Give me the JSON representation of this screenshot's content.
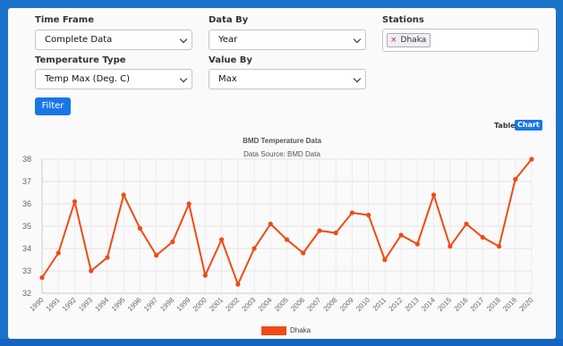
{
  "filters": {
    "time_frame": {
      "label": "Time Frame",
      "value": "Complete Data"
    },
    "data_by": {
      "label": "Data By",
      "value": "Year"
    },
    "stations": {
      "label": "Stations",
      "tags": [
        {
          "remove": "×",
          "name": "Dhaka"
        }
      ]
    },
    "temperature_type": {
      "label": "Temperature Type",
      "value": "Temp Max (Deg. C)"
    },
    "value_by": {
      "label": "Value By",
      "value": "Max"
    }
  },
  "filter_button": "Filter",
  "view_toggle": {
    "table": "Table",
    "chart": "Chart"
  },
  "colors": {
    "series": "#f04a14",
    "button": "#1976e8",
    "frame": "#1a73c8"
  },
  "chart_data": {
    "type": "line",
    "title": "BMD Temperature Data",
    "subtitle": "Data Source: BMD Data",
    "x": [
      "1990",
      "1991",
      "1992",
      "1993",
      "1994",
      "1995",
      "1996",
      "1997",
      "1998",
      "1999",
      "2000",
      "2001",
      "2002",
      "2003",
      "2004",
      "2005",
      "2006",
      "2007",
      "2008",
      "2009",
      "2010",
      "2011",
      "2012",
      "2013",
      "2014",
      "2015",
      "2016",
      "2017",
      "2018",
      "2019",
      "2020"
    ],
    "series": [
      {
        "name": "Dhaka",
        "values": [
          32.7,
          33.8,
          36.1,
          33.0,
          33.6,
          36.4,
          34.9,
          33.7,
          34.3,
          36.0,
          32.8,
          34.4,
          32.4,
          34.0,
          35.1,
          34.4,
          33.8,
          34.8,
          34.7,
          35.6,
          35.5,
          33.5,
          34.6,
          34.2,
          36.4,
          34.1,
          35.1,
          34.5,
          34.1,
          37.1,
          38.0
        ]
      }
    ],
    "ylim": [
      32,
      38
    ],
    "yticks": [
      "32",
      "33",
      "34",
      "35",
      "36",
      "37",
      "38"
    ],
    "grid": true,
    "legend": "bottom"
  }
}
